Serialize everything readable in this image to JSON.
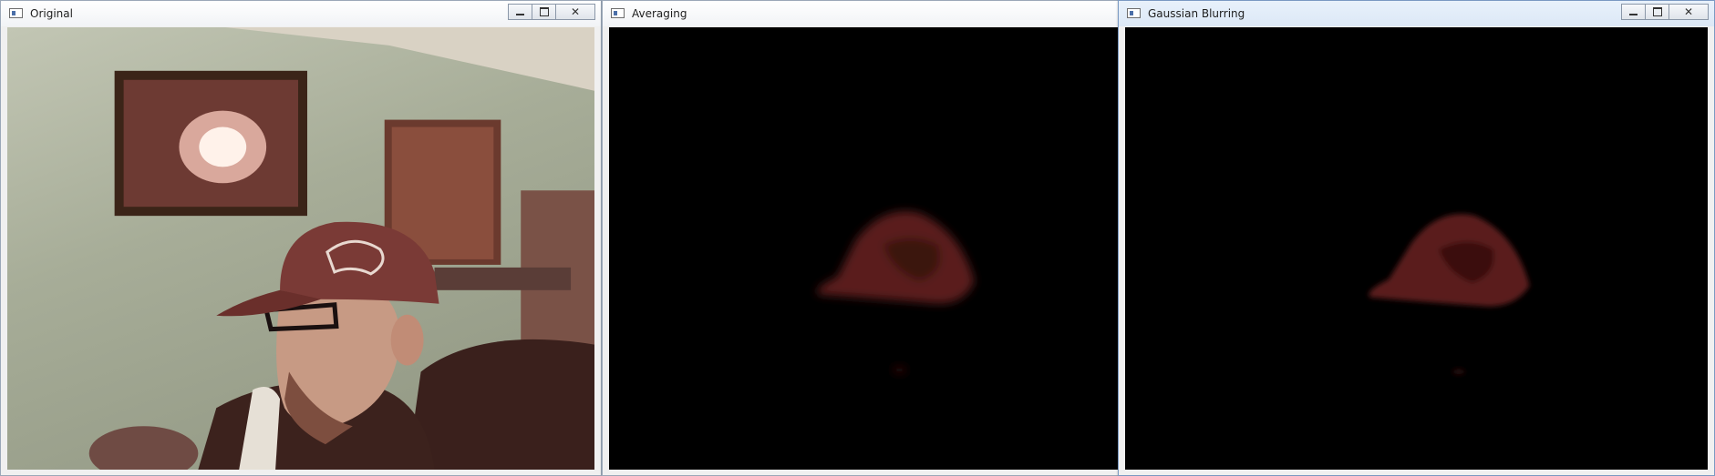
{
  "windows": {
    "original": {
      "title": "Original"
    },
    "averaging": {
      "title": "Averaging"
    },
    "gaussian": {
      "title": "Gaussian Blurring"
    }
  },
  "controls": {
    "minimize": "minimize",
    "maximize": "maximize",
    "close": "close"
  },
  "colors": {
    "wall": "#a3a892",
    "cap": "#7a3a36",
    "mask_red": "#5a1c1a",
    "background": "#000000"
  }
}
